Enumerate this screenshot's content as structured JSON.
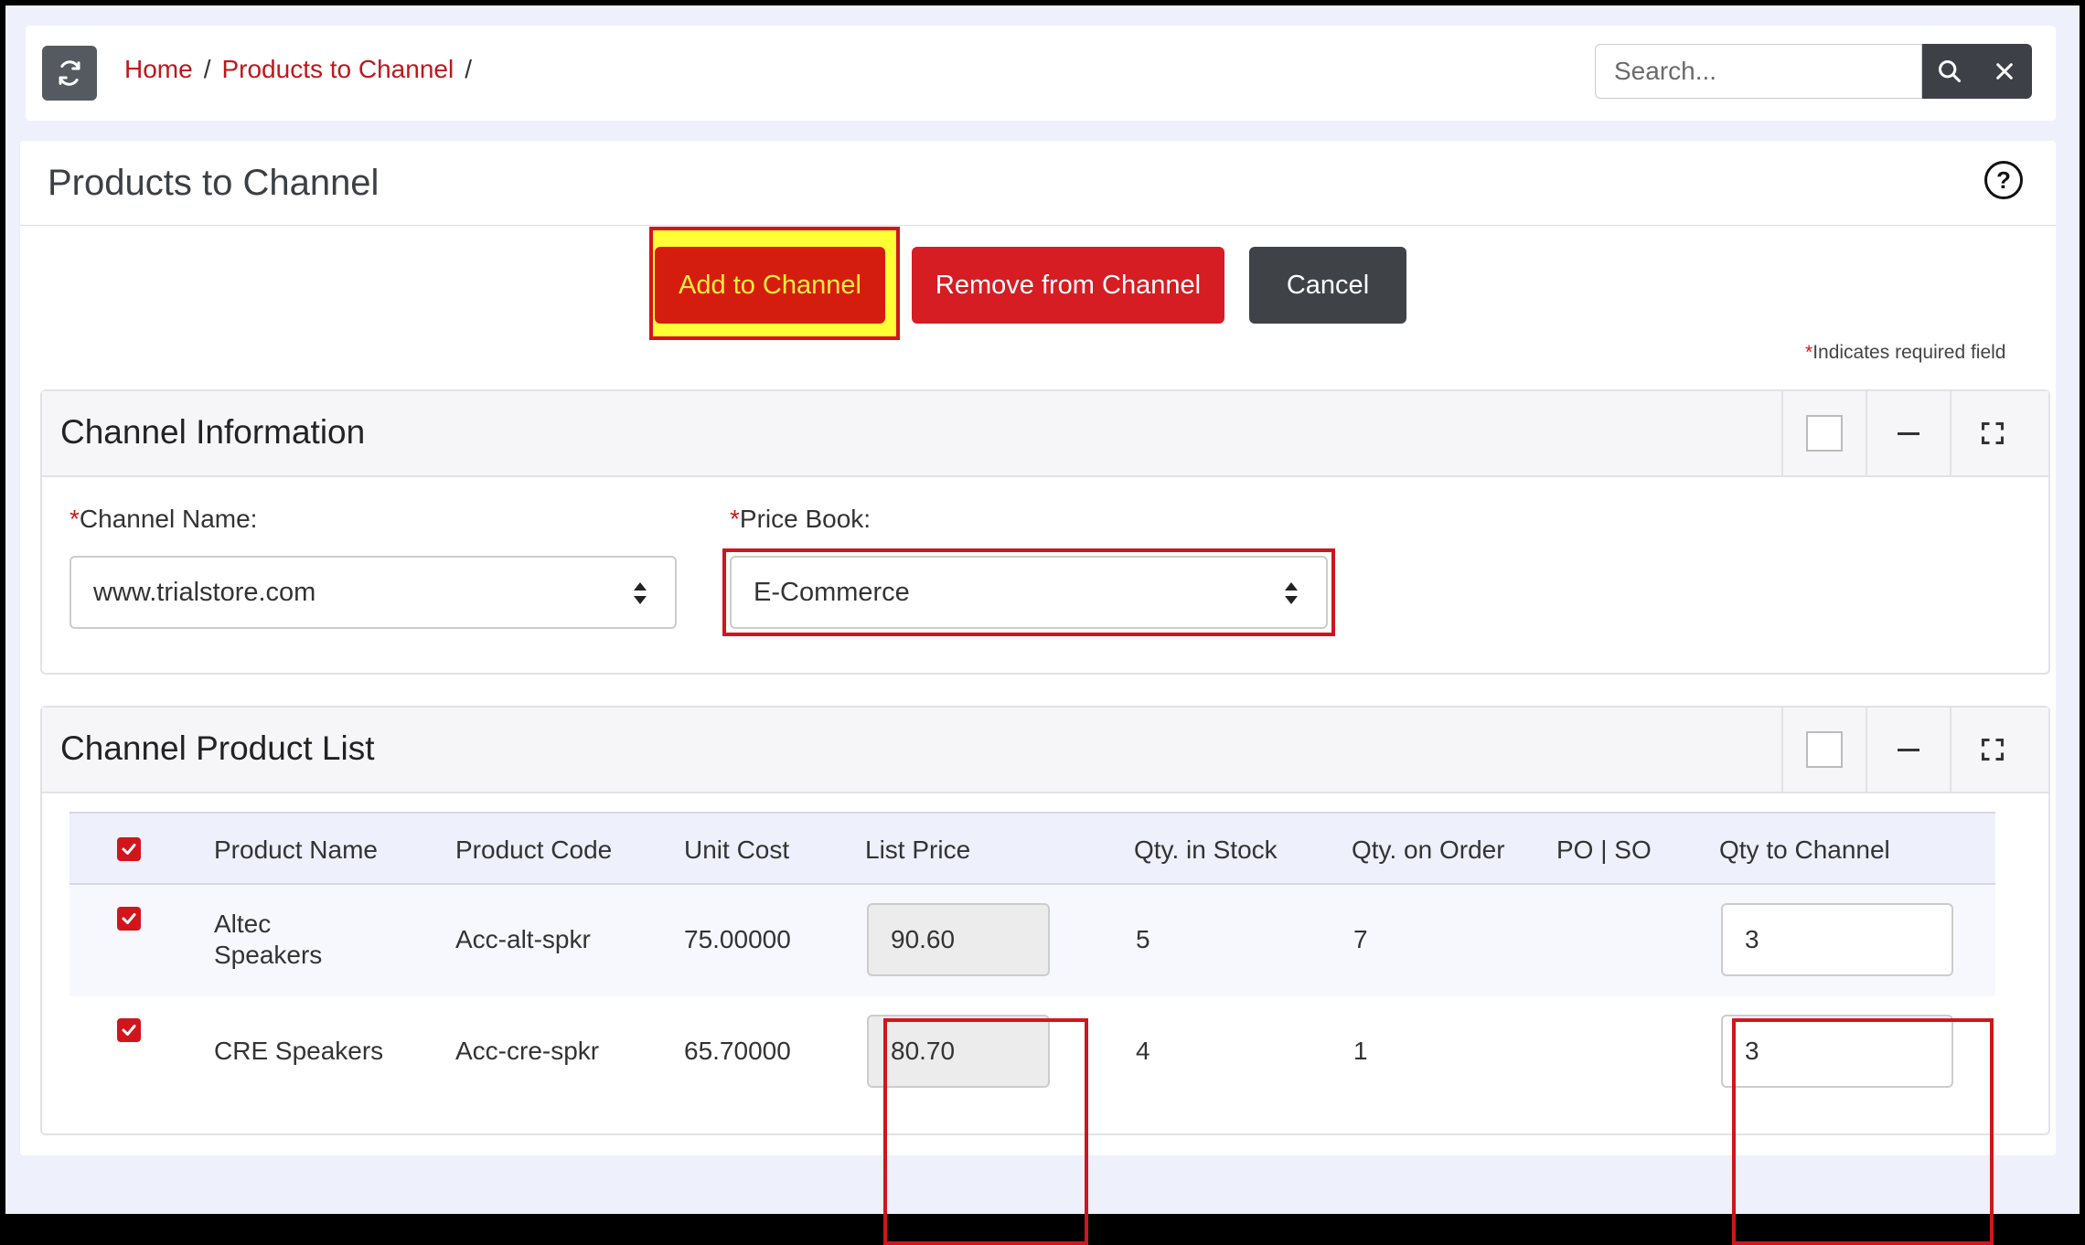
{
  "breadcrumb": {
    "home": "Home",
    "current": "Products to Channel",
    "separator": "/"
  },
  "search": {
    "placeholder": "Search..."
  },
  "icons": {
    "refresh": "refresh-icon",
    "search": "search-icon",
    "close": "close-icon",
    "help": "help-icon",
    "minimize": "minus-icon",
    "expand": "expand-icon",
    "check": "check-icon",
    "sort": "sort-arrows-icon"
  },
  "page": {
    "title": "Products to Channel",
    "help_glyph": "?"
  },
  "actions": {
    "add": "Add to Channel",
    "remove": "Remove from Channel",
    "cancel": "Cancel"
  },
  "required_note": {
    "star": "*",
    "text": "Indicates required field"
  },
  "channel_info": {
    "title": "Channel Information",
    "channel_name_label": "Channel Name:",
    "channel_name_value": "www.trialstore.com",
    "price_book_label": "Price Book:",
    "price_book_value": "E-Commerce",
    "required_star": "*"
  },
  "product_list": {
    "title": "Channel Product List",
    "columns": [
      "Product Name",
      "Product Code",
      "Unit Cost",
      "List Price",
      "Qty. in Stock",
      "Qty. on Order",
      "PO | SO",
      "Qty to Channel"
    ],
    "rows": [
      {
        "checked": true,
        "name": "Altec Speakers",
        "code": "Acc-alt-spkr",
        "unit_cost": "75.00000",
        "list_price": "90.60",
        "in_stock": "5",
        "on_order": "7",
        "po_so": "",
        "qty_to_channel": "3"
      },
      {
        "checked": true,
        "name": "CRE Speakers",
        "code": "Acc-cre-spkr",
        "unit_cost": "65.70000",
        "list_price": "80.70",
        "in_stock": "4",
        "on_order": "1",
        "po_so": "",
        "qty_to_channel": "3"
      }
    ]
  },
  "colors": {
    "accent_red": "#d0161c",
    "dark_button": "#3f4348",
    "highlight_yellow": "#ffff35"
  }
}
